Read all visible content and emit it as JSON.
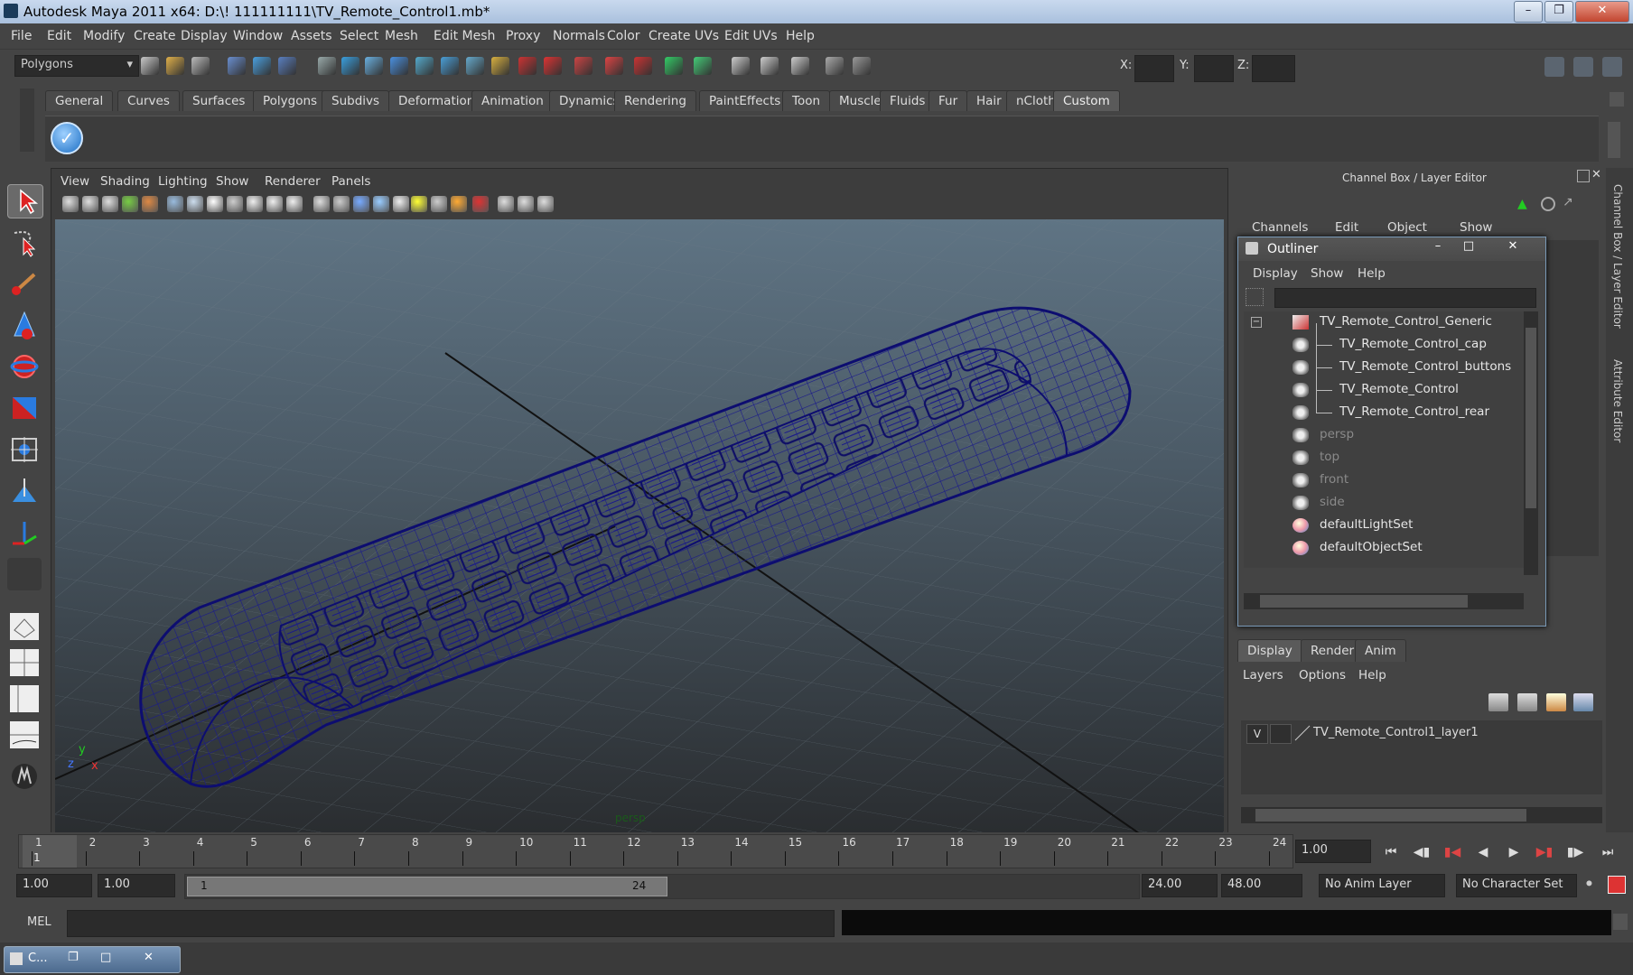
{
  "window": {
    "title": "Autodesk Maya 2011 x64: D:\\! 111111111\\TV_Remote_Control1.mb*"
  },
  "menubar": [
    "File",
    "Edit",
    "Modify",
    "Create",
    "Display",
    "Window",
    "Assets",
    "Select",
    "Mesh",
    "Edit Mesh",
    "Proxy",
    "Normals",
    "Color",
    "Create UVs",
    "Edit UVs",
    "Help"
  ],
  "statusline": {
    "mode": "Polygons",
    "x_label": "X:",
    "y_label": "Y:",
    "z_label": "Z:"
  },
  "shelf": {
    "tabs": [
      "General",
      "Curves",
      "Surfaces",
      "Polygons",
      "Subdivs",
      "Deformation",
      "Animation",
      "Dynamics",
      "Rendering",
      "PaintEffects",
      "Toon",
      "Muscle",
      "Fluids",
      "Fur",
      "Hair",
      "nCloth",
      "Custom"
    ],
    "active": "Custom"
  },
  "viewport": {
    "menu": [
      "View",
      "Shading",
      "Lighting",
      "Show",
      "Renderer",
      "Panels"
    ],
    "camera": "persp",
    "axis_x": "x",
    "axis_y": "y",
    "axis_z": "z"
  },
  "channelbox": {
    "title": "Channel Box / Layer Editor",
    "menu": [
      "Channels",
      "Edit",
      "Object",
      "Show"
    ]
  },
  "outliner": {
    "title": "Outliner",
    "menu": [
      "Display",
      "Show",
      "Help"
    ],
    "items": [
      {
        "label": "TV_Remote_Control_Generic",
        "level": 0,
        "dim": false
      },
      {
        "label": "TV_Remote_Control_cap",
        "level": 1,
        "dim": false
      },
      {
        "label": "TV_Remote_Control_buttons",
        "level": 1,
        "dim": false
      },
      {
        "label": "TV_Remote_Control",
        "level": 1,
        "dim": false
      },
      {
        "label": "TV_Remote_Control_rear",
        "level": 1,
        "dim": false
      },
      {
        "label": "persp",
        "level": 0,
        "dim": true
      },
      {
        "label": "top",
        "level": 0,
        "dim": true
      },
      {
        "label": "front",
        "level": 0,
        "dim": true
      },
      {
        "label": "side",
        "level": 0,
        "dim": true
      },
      {
        "label": "defaultLightSet",
        "level": 0,
        "dim": false
      },
      {
        "label": "defaultObjectSet",
        "level": 0,
        "dim": false
      }
    ]
  },
  "layereditor": {
    "tabs": [
      "Display",
      "Render",
      "Anim"
    ],
    "menu": [
      "Layers",
      "Options",
      "Help"
    ],
    "layer_visible": "V",
    "layer_name": "TV_Remote_Control1_layer1"
  },
  "sidetabs": [
    "Channel Box / Layer Editor",
    "Attribute Editor"
  ],
  "timeline": {
    "ticks": [
      "1",
      "2",
      "3",
      "4",
      "5",
      "6",
      "7",
      "8",
      "9",
      "10",
      "11",
      "12",
      "13",
      "14",
      "15",
      "16",
      "17",
      "18",
      "19",
      "20",
      "21",
      "22",
      "23",
      "24"
    ],
    "current_frame_marker": "1",
    "current_time": "1.00"
  },
  "range": {
    "start": "1.00",
    "start2": "1.00",
    "slider_start": "1",
    "slider_end": "24",
    "end": "24.00",
    "end2": "48.00",
    "anim_layer": "No Anim Layer",
    "char_set": "No Character Set"
  },
  "cmdline": {
    "label": "MEL"
  },
  "taskbar": {
    "item": "C..."
  },
  "colors": {
    "wire": "#1a1a8a",
    "panel": "#444444",
    "accent": "#5b7a9c"
  }
}
